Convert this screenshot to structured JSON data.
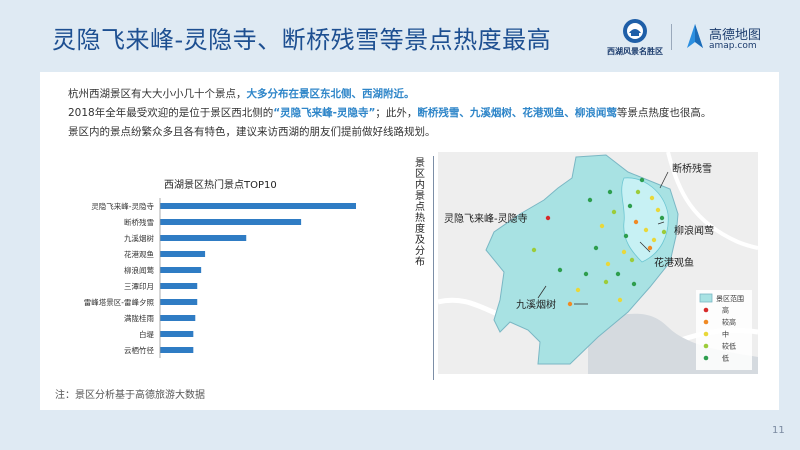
{
  "slide": {
    "title": "灵隐飞来峰-灵隐寺、断桥残雪等景点热度最高",
    "page_number": "11",
    "logos": {
      "xihu_text": "西湖风景名胜区",
      "amap_name": "高德地图",
      "amap_url": "amap.com"
    }
  },
  "intro": {
    "line1_a": "杭州西湖景区有大大小小几十个景点，",
    "line1_b": "大多分布在景区东北侧、西湖附近。",
    "line2_a": "2018年全年最受欢迎的是位于景区西北侧的",
    "line2_b": "“灵隐飞来峰-灵隐寺”",
    "line2_c": "；此外，",
    "line2_d": "断桥残雪、九溪烟树、花港观鱼、柳浪闻莺",
    "line2_e": "等景点热度也很高。",
    "line3": "景区内的景点纷繁众多且各有特色，建议来访西湖的朋友们提前做好线路规划。"
  },
  "footnote": "注：景区分析基于高德旅游大数据",
  "map": {
    "caption": "景区内景点热度及分布",
    "labels": {
      "lingyin": "灵隐飞来峰-灵隐寺",
      "duanqiao": "断桥残雪",
      "liulang": "柳浪闻莺",
      "huagang": "花港观鱼",
      "jiuxi": "九溪烟树"
    },
    "legend": {
      "area": "景区范围",
      "levels": [
        "高",
        "较高",
        "中",
        "较低",
        "低"
      ],
      "colors": [
        "#d62a2a",
        "#f08a24",
        "#e9d83a",
        "#9ccc3a",
        "#2e9e4e"
      ]
    },
    "area_fill": "#a8e2e3",
    "area_stroke": "#7ab7c4"
  },
  "chart_data": {
    "type": "bar",
    "orientation": "horizontal",
    "title": "西湖景区热门景点TOP10",
    "categories": [
      "灵隐飞来峰-灵隐寺",
      "断桥残雪",
      "九溪烟树",
      "花港观鱼",
      "柳浪闻莺",
      "三潭印月",
      "雷峰塔景区-雷峰夕照",
      "满陇桂雨",
      "白堤",
      "云栖竹径"
    ],
    "values": [
      100,
      72,
      44,
      23,
      21,
      19,
      19,
      18,
      17,
      17
    ],
    "xlim": [
      0,
      100
    ],
    "bar_color": "#2f7cc4",
    "grid": false
  }
}
